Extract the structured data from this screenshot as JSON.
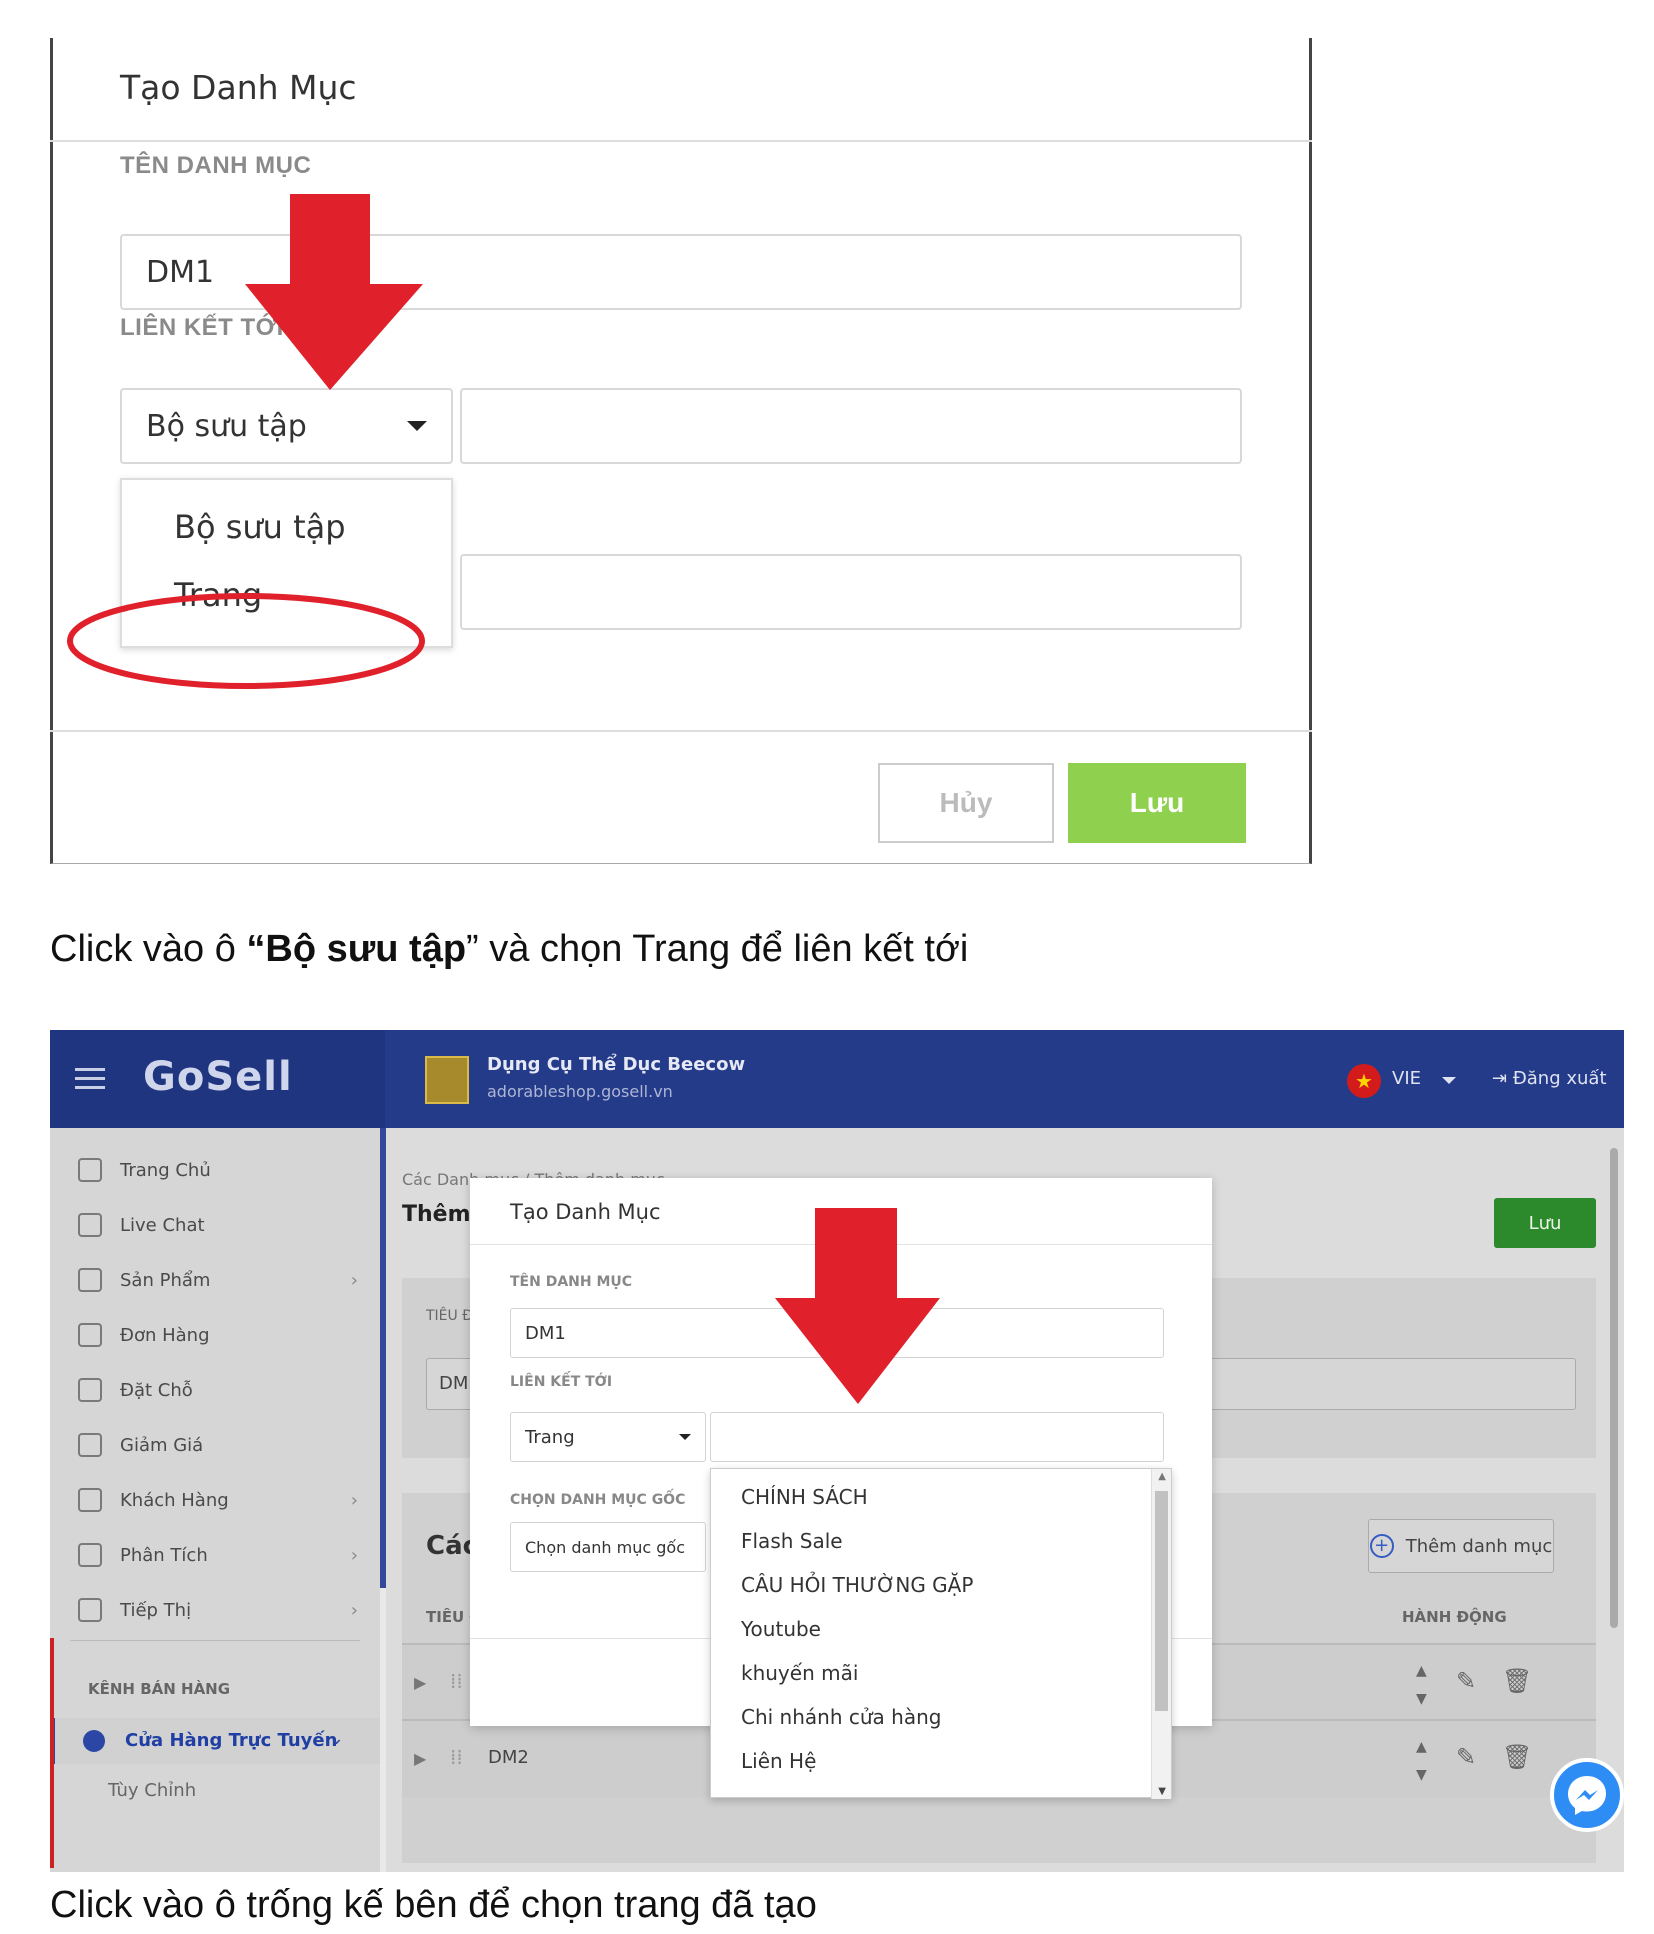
{
  "top_shot": {
    "modal_title": "Tạo Danh Mục",
    "name_label": "TÊN DANH MỤC",
    "name_value": "DM1",
    "link_label": "LIÊN KẾT TỚI",
    "link_select_value": "Bộ sưu tập",
    "link_options": [
      "Bộ sưu tập",
      "Trang"
    ],
    "cancel_label": "Hủy",
    "save_label": "Lưu",
    "colors": {
      "save_button": "#8fd14f",
      "annotation_red": "#e0212b"
    }
  },
  "caption1": {
    "prefix": "Click vào ô ",
    "bold": "“Bộ sưu tập",
    "suffix": "” và chọn Trang để liên kết tới"
  },
  "bottom_shot": {
    "brand": "GoSell",
    "shop_name": "Dụng Cụ Thể Dục Beecow",
    "shop_url": "adorableshop.gosell.vn",
    "language": "VIE",
    "logout_label": "Đăng xuất",
    "sidebar": {
      "items": [
        {
          "label": "Trang Chủ",
          "icon": "home-icon",
          "has_children": false
        },
        {
          "label": "Live Chat",
          "icon": "chat-icon",
          "has_children": false
        },
        {
          "label": "Sản Phẩm",
          "icon": "tag-icon",
          "has_children": true
        },
        {
          "label": "Đơn Hàng",
          "icon": "receipt-icon",
          "has_children": false
        },
        {
          "label": "Đặt Chỗ",
          "icon": "calendar-icon",
          "has_children": false
        },
        {
          "label": "Giảm Giá",
          "icon": "discount-icon",
          "has_children": false
        },
        {
          "label": "Khách Hàng",
          "icon": "users-icon",
          "has_children": true
        },
        {
          "label": "Phân Tích",
          "icon": "chart-icon",
          "has_children": true
        },
        {
          "label": "Tiếp Thị",
          "icon": "bulb-icon",
          "has_children": true
        }
      ],
      "section_title": "KÊNH BÁN HÀNG",
      "active_item": "Cửa Hàng Trực Tuyến",
      "sub_item": "Tùy Chỉnh"
    },
    "breadcrumb": "Các Danh mục / Thêm danh mục",
    "page_title": "Thêm danh mục",
    "save_label": "Lưu",
    "title_field_label": "TIÊU ĐỀ",
    "title_field_value": "DM",
    "list_heading": "Các danh mục",
    "add_category_label": "Thêm danh mục",
    "col_title": "TIÊU ĐỀ",
    "col_actions": "HÀNH ĐỘNG",
    "rows": [
      {
        "name": ""
      },
      {
        "name": "DM2"
      }
    ],
    "modal": {
      "title": "Tạo Danh Mục",
      "name_label": "TÊN DANH MỤC",
      "name_value": "DM1",
      "link_label": "LIÊN KẾT TỚI",
      "link_type_value": "Trang",
      "link_target_value": "",
      "parent_label": "CHỌN DANH MỤC GỐC",
      "parent_placeholder": "Chọn danh mục gốc"
    },
    "page_options": [
      "CHÍNH SÁCH",
      "Flash Sale",
      "CÂU HỎI THƯỜNG GẶP",
      "Youtube",
      "khuyến mãi",
      "Chi nhánh cửa hàng",
      "Liên Hệ"
    ],
    "colors": {
      "topbar": "#243b8a",
      "save_button": "#2c8a2c",
      "messenger": "#2e8df5"
    }
  },
  "caption2": {
    "text": "Click vào ô trống kế bên để chọn trang đã tạo"
  }
}
